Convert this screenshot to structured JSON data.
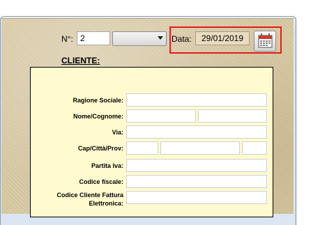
{
  "header": {
    "number_label": "N°:",
    "number_value": "2",
    "dropdown_value": "",
    "date_label": "Data:",
    "date_value": "29/01/2019"
  },
  "section": {
    "title": "CLIENTE:"
  },
  "form": {
    "ragione_sociale": "Ragione Sociale:",
    "nome_cognome": "Nome/Cognome:",
    "via": "Via:",
    "cap_citta_prov": "Cap/Città/Prov:",
    "partita_iva": "Partita Iva:",
    "codice_fiscale": "Codice fiscale:",
    "codice_cliente_line1": "Codice Cliente Fattura",
    "codice_cliente_line2": "Elettronica:"
  },
  "colors": {
    "highlight": "#e21b1b",
    "panel": "#fffbcf",
    "background": "#d9c9a4"
  },
  "icons": {
    "calendar": "calendar-icon"
  }
}
